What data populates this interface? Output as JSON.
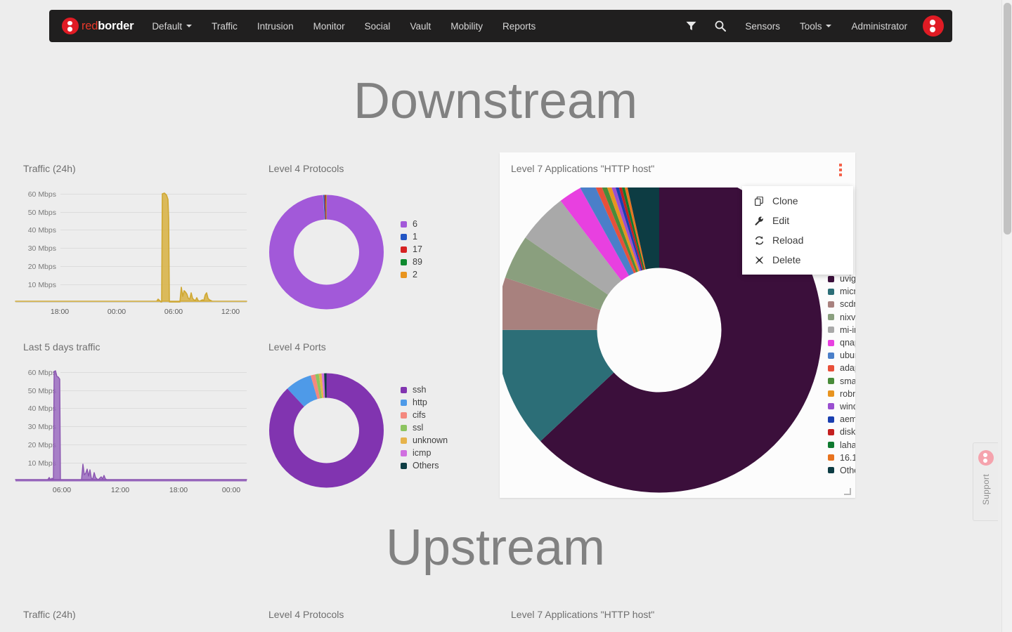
{
  "navbar": {
    "brand": {
      "part1": "red",
      "part2": "border",
      "logo_icon": "redborder-logo-icon"
    },
    "items": [
      {
        "label": "Default",
        "has_caret": true
      },
      {
        "label": "Traffic",
        "has_caret": false
      },
      {
        "label": "Intrusion",
        "has_caret": false
      },
      {
        "label": "Monitor",
        "has_caret": false
      },
      {
        "label": "Social",
        "has_caret": false
      },
      {
        "label": "Vault",
        "has_caret": false
      },
      {
        "label": "Mobility",
        "has_caret": false
      },
      {
        "label": "Reports",
        "has_caret": false
      }
    ],
    "right_items": [
      {
        "label": "Sensors",
        "has_caret": false
      },
      {
        "label": "Tools",
        "has_caret": true
      },
      {
        "label": "Administrator",
        "has_caret": false
      }
    ],
    "filter_icon": "filter-icon",
    "search_icon": "search-icon",
    "avatar_icon": "user-avatar-icon"
  },
  "sections": {
    "downstream_heading": "Downstream",
    "upstream_heading": "Upstream"
  },
  "downstream": {
    "traffic_title": "Traffic (24h)",
    "last5_title": "Last 5 days traffic",
    "protocols_title": "Level 4 Protocols",
    "ports_title": "Level 4 Ports",
    "apps_title": "Level 7 Applications \"HTTP host\""
  },
  "upstream": {
    "traffic_title": "Traffic (24h)",
    "protocols_title": "Level 4 Protocols",
    "apps_title": "Level 7 Applications \"HTTP host\""
  },
  "context_menu": {
    "items": [
      {
        "label": "Clone",
        "icon": "clone-icon",
        "glyph": "❐"
      },
      {
        "label": "Edit",
        "icon": "wrench-icon",
        "glyph": "ὒ7"
      },
      {
        "label": "Reload",
        "icon": "reload-icon",
        "glyph": "↻"
      },
      {
        "label": "Delete",
        "icon": "close-icon",
        "glyph": "✖"
      }
    ]
  },
  "support": {
    "label": "Support",
    "icon": "support-logo-icon"
  },
  "colors": {
    "navbar_bg": "#201f1f",
    "page_bg": "#ededed",
    "brand_red": "#e8392b",
    "kebab_orange": "#f4624a",
    "heading_gray": "#818181",
    "traffic_line": "#d4ad3c",
    "last5_line": "#8e5ab4"
  },
  "chart_data": [
    {
      "id": "downstream-traffic-24h",
      "type": "area",
      "title": "Traffic (24h)",
      "xlabel": "",
      "ylabel": "",
      "ylim": [
        0,
        65
      ],
      "grid": true,
      "color": "#d4ad3c",
      "ytick_labels": [
        "10 Mbps",
        "20 Mbps",
        "30 Mbps",
        "40 Mbps",
        "50 Mbps",
        "60 Mbps"
      ],
      "ytick_values": [
        10,
        20,
        30,
        40,
        50,
        60
      ],
      "xtick_labels": [
        "18:00",
        "00:00",
        "06:00",
        "12:00"
      ],
      "x": [
        0,
        1,
        2,
        3,
        4,
        5,
        6,
        7,
        8,
        9,
        10,
        11,
        12,
        13,
        14,
        15,
        16,
        17,
        18,
        19,
        20,
        21,
        22,
        23,
        24,
        25,
        26,
        27,
        28,
        29,
        30,
        31,
        32,
        33,
        34,
        35,
        36,
        37,
        38,
        39,
        40,
        41,
        42,
        43,
        44,
        45,
        46,
        47,
        48,
        49,
        50,
        51,
        52,
        53,
        54,
        55,
        56,
        57,
        58,
        59,
        60,
        61,
        62,
        63,
        64,
        65,
        66,
        67,
        68,
        69,
        70,
        71,
        72,
        73,
        74,
        75,
        76,
        77,
        78,
        79,
        80,
        81,
        82,
        83,
        84,
        85,
        86,
        87,
        88,
        89,
        90,
        91,
        92,
        93,
        94,
        95,
        96,
        97,
        98,
        99
      ],
      "values": [
        0.3,
        0.3,
        0.3,
        0.3,
        0.3,
        0.3,
        0.3,
        0.3,
        0.3,
        0.3,
        0.3,
        0.3,
        0.3,
        0.3,
        0.3,
        0.3,
        0.3,
        0.3,
        0.3,
        0.3,
        0.3,
        0.3,
        0.3,
        0.3,
        0.3,
        0.3,
        0.3,
        0.3,
        0.3,
        0.3,
        0.3,
        0.3,
        0.3,
        0.3,
        0.3,
        0.3,
        0.3,
        0.3,
        0.3,
        0.3,
        0.3,
        0.3,
        0.3,
        0.3,
        0.3,
        0.3,
        0.3,
        0.3,
        0.3,
        0.3,
        0.3,
        0.3,
        0.3,
        0.3,
        0.3,
        0.3,
        0.3,
        0.3,
        0.3,
        1.2,
        0.8,
        0.4,
        58,
        61,
        60,
        59,
        57,
        55,
        0.4,
        0.3,
        0.3,
        0.3,
        0.3,
        0.3,
        0.3,
        0.3,
        0.3,
        0.3,
        8,
        3,
        5.5,
        5,
        4.5,
        4,
        2,
        1.5,
        4,
        2,
        1,
        1,
        2.2,
        1.2,
        0.8,
        1,
        1.5,
        1.2,
        3.5,
        4.5,
        2,
        1.5,
        1.2,
        0.8
      ]
    },
    {
      "id": "downstream-last-5-days",
      "type": "area",
      "title": "Last 5 days traffic",
      "xlabel": "",
      "ylabel": "",
      "ylim": [
        0,
        65
      ],
      "grid": true,
      "color": "#8e5ab4",
      "ytick_labels": [
        "10 Mbps",
        "20 Mbps",
        "30 Mbps",
        "40 Mbps",
        "50 Mbps",
        "60 Mbps"
      ],
      "ytick_values": [
        10,
        20,
        30,
        40,
        50,
        60
      ],
      "xtick_labels": [
        "06:00",
        "12:00",
        "18:00",
        "00:00"
      ],
      "x": [
        0,
        1,
        2,
        3,
        4,
        5,
        6,
        7,
        8,
        9,
        10,
        11,
        12,
        13,
        14,
        15,
        16,
        17,
        18,
        19,
        20,
        21,
        22,
        23,
        24,
        25,
        26,
        27,
        28,
        29,
        30,
        31,
        32,
        33,
        34,
        35,
        36,
        37,
        38,
        39,
        40,
        41,
        42,
        43,
        44,
        45,
        46,
        47,
        48,
        49,
        50,
        51,
        52,
        53,
        54,
        55,
        56,
        57,
        58,
        59,
        60,
        61,
        62,
        63,
        64,
        65,
        66,
        67,
        68,
        69,
        70,
        71,
        72,
        73,
        74,
        75,
        76,
        77,
        78,
        79,
        80,
        81,
        82,
        83,
        84,
        85,
        86,
        87,
        88,
        89,
        90,
        91,
        92,
        93,
        94,
        95,
        96,
        97,
        98,
        99
      ],
      "values": [
        0.3,
        0.3,
        0.3,
        0.3,
        0.3,
        0.3,
        0.3,
        0.3,
        0.3,
        0.3,
        0.3,
        0.3,
        0.3,
        0.3,
        0.3,
        0.3,
        1.2,
        0.5,
        61,
        58,
        57,
        56,
        55,
        0.4,
        0.3,
        0.3,
        0.3,
        0.3,
        0.3,
        0.3,
        0.3,
        8,
        2,
        5,
        4.5,
        4.5,
        2,
        1.2,
        5,
        2,
        1.5,
        1,
        3.5,
        1.5,
        0.8,
        0.5,
        0.8,
        1.5,
        1,
        2,
        4,
        1.5,
        0.8,
        0.6,
        0.5,
        0.4,
        0.3,
        0.3,
        0.3,
        0.3,
        0.3,
        0.3,
        0.3,
        0.3,
        0.3,
        0.3,
        0.3,
        0.3,
        0.3,
        0.3,
        0.3,
        0.3,
        0.3,
        0.3,
        0.3,
        0.3,
        0.3,
        0.3,
        0.3,
        0.3,
        0.3,
        0.3,
        0.3,
        0.3,
        0.3,
        0.3,
        0.3,
        0.3,
        0.3,
        0.3,
        0.3,
        0.3,
        0.3,
        0.3,
        0.3,
        0.3,
        0.3,
        0.3,
        0.3,
        0.3,
        0.3
      ]
    },
    {
      "id": "downstream-level4-protocols",
      "type": "pie",
      "title": "Level 4 Protocols",
      "donut": true,
      "legend_position": "right",
      "labels": [
        "6",
        "1",
        "17",
        "89",
        "2"
      ],
      "values": [
        99.0,
        0.35,
        0.35,
        0.15,
        0.15
      ],
      "colors": [
        "#a259d9",
        "#2255c4",
        "#d62222",
        "#0f8a2f",
        "#e8941f"
      ]
    },
    {
      "id": "downstream-level4-ports",
      "type": "pie",
      "title": "Level 4 Ports",
      "donut": true,
      "legend_position": "right",
      "labels": [
        "ssh",
        "http",
        "cifs",
        "ssl",
        "unknown",
        "icmp",
        "Others"
      ],
      "values": [
        88.0,
        7.5,
        1.3,
        1.0,
        0.8,
        0.7,
        0.7
      ],
      "colors": [
        "#8134b0",
        "#4e9ae8",
        "#f4887e",
        "#8cc45f",
        "#e6b34a",
        "#d06fe0",
        "#0d3c43"
      ]
    },
    {
      "id": "downstream-level7-applications",
      "type": "pie",
      "title": "Level 7 Applications \"HTTP host\"",
      "donut": true,
      "legend_position": "right",
      "labels": [
        "uvigo",
        "microsoft",
        "scdn",
        "nixval",
        "mi-internal",
        "qnap",
        "ubuntu",
        "adaptive",
        "smart",
        "robnet",
        "windows",
        "aem",
        "diskstation",
        "lahaus",
        "16.1",
        "Others"
      ],
      "values": [
        63.0,
        12.0,
        5.2,
        4.4,
        5.0,
        2.3,
        1.4,
        0.6,
        0.5,
        0.45,
        0.4,
        0.35,
        0.3,
        0.3,
        0.3,
        3.5
      ],
      "colors": [
        "#3b0f3b",
        "#2c6e77",
        "#a8817e",
        "#8a9f7e",
        "#a9a9a9",
        "#e840e0",
        "#4a7fc9",
        "#e8503a",
        "#4a8c3a",
        "#e8941f",
        "#9a4fd0",
        "#1a3fb0",
        "#c42020",
        "#0f7a2f",
        "#e8731f",
        "#0d3c43"
      ]
    },
    {
      "id": "upstream-traffic-24h",
      "type": "area",
      "title": "Traffic (24h)",
      "color": "#d4ad3c",
      "values": []
    },
    {
      "id": "upstream-level4-protocols",
      "type": "pie",
      "title": "Level 4 Protocols",
      "donut": true,
      "labels": [],
      "values": []
    },
    {
      "id": "upstream-level7-applications",
      "type": "pie",
      "title": "Level 7 Applications \"HTTP host\"",
      "donut": true,
      "labels": [],
      "values": []
    }
  ],
  "legends": {
    "protocols": [
      {
        "label": "6",
        "color": "#a259d9"
      },
      {
        "label": "1",
        "color": "#2255c4"
      },
      {
        "label": "17",
        "color": "#d62222"
      },
      {
        "label": "89",
        "color": "#0f8a2f"
      },
      {
        "label": "2",
        "color": "#e8941f"
      }
    ],
    "ports": [
      {
        "label": "ssh",
        "color": "#8134b0"
      },
      {
        "label": "http",
        "color": "#4e9ae8"
      },
      {
        "label": "cifs",
        "color": "#f4887e"
      },
      {
        "label": "ssl",
        "color": "#8cc45f"
      },
      {
        "label": "unknown",
        "color": "#e6b34a"
      },
      {
        "label": "icmp",
        "color": "#d06fe0"
      },
      {
        "label": "Others",
        "color": "#0d3c43"
      }
    ],
    "applications": [
      {
        "label": "uvigo",
        "color": "#3b0f3b"
      },
      {
        "label": "micro",
        "color": "#2c6e77"
      },
      {
        "label": "scdn",
        "color": "#a8817e"
      },
      {
        "label": "nixval",
        "color": "#8a9f7e"
      },
      {
        "label": "mi-in",
        "color": "#a9a9a9"
      },
      {
        "label": "qnap",
        "color": "#e840e0"
      },
      {
        "label": "ubun",
        "color": "#4a7fc9"
      },
      {
        "label": "adap",
        "color": "#e8503a"
      },
      {
        "label": "sma",
        "color": "#4a8c3a"
      },
      {
        "label": "robn",
        "color": "#e8941f"
      },
      {
        "label": "wind",
        "color": "#9a4fd0"
      },
      {
        "label": "aem",
        "color": "#1a3fb0"
      },
      {
        "label": "disk",
        "color": "#c42020"
      },
      {
        "label": "laha",
        "color": "#0f7a2f"
      },
      {
        "label": "16.1",
        "color": "#e8731f"
      },
      {
        "label": "Othe",
        "color": "#0d3c43"
      }
    ]
  }
}
